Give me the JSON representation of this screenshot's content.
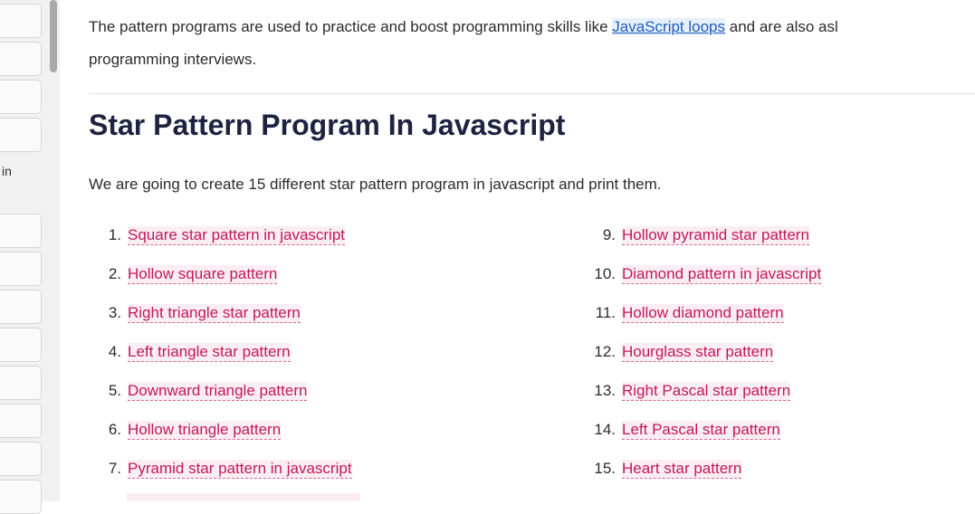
{
  "sidebar": {
    "label": "in"
  },
  "article": {
    "intro_before": "The pattern programs are used to practice and boost programming skills like ",
    "intro_link": "JavaScript loops",
    "intro_after": " and are also asl",
    "intro_line2": "programming interviews.",
    "heading": "Star Pattern Program In Javascript",
    "description": "We are going to create 15 different star pattern program in javascript and print them.",
    "list_left": [
      {
        "num": "1.",
        "label": "Square star pattern in javascript"
      },
      {
        "num": "2.",
        "label": "Hollow square pattern"
      },
      {
        "num": "3.",
        "label": "Right triangle star pattern"
      },
      {
        "num": "4.",
        "label": "Left triangle star pattern"
      },
      {
        "num": "5.",
        "label": "Downward triangle pattern"
      },
      {
        "num": "6.",
        "label": "Hollow triangle pattern"
      },
      {
        "num": "7.",
        "label": "Pyramid star pattern in javascript"
      }
    ],
    "list_right": [
      {
        "num": "9.",
        "label": "Hollow pyramid star pattern"
      },
      {
        "num": "10.",
        "label": "Diamond pattern in javascript"
      },
      {
        "num": "11.",
        "label": "Hollow diamond pattern"
      },
      {
        "num": "12.",
        "label": "Hourglass star pattern"
      },
      {
        "num": "13.",
        "label": "Right Pascal star pattern"
      },
      {
        "num": "14.",
        "label": "Left Pascal star pattern"
      },
      {
        "num": "15.",
        "label": "Heart star pattern"
      }
    ]
  },
  "colors": {
    "link": "#1f5fbf",
    "list_link": "#c2185b",
    "heading": "#1e2340"
  }
}
